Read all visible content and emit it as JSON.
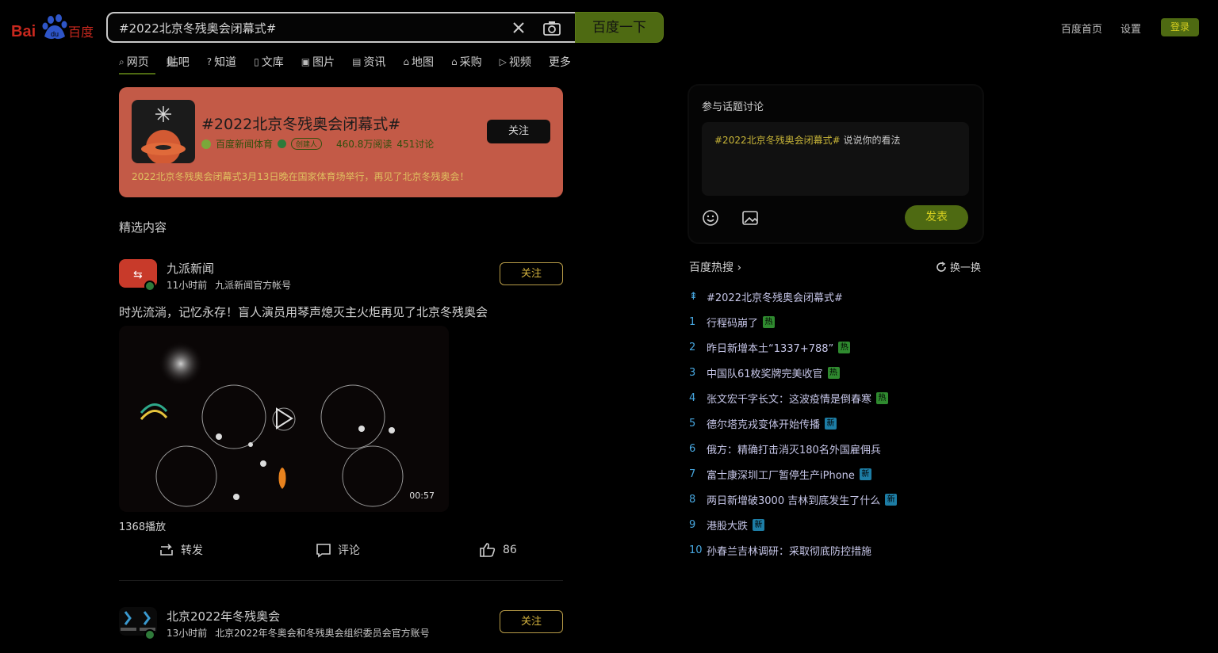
{
  "header": {
    "logo_text": "Bai 百度",
    "search_value": "#2022北京冬残奥会闭幕式#",
    "search_button": "百度一下",
    "links": [
      "百度首页",
      "设置"
    ],
    "login": "登录"
  },
  "nav": {
    "items": [
      {
        "label": "网页",
        "icon": "search-icon"
      },
      {
        "label": "贴吧",
        "icon": "tieba-icon"
      },
      {
        "label": "知道",
        "icon": "question-icon"
      },
      {
        "label": "文库",
        "icon": "doc-icon"
      },
      {
        "label": "图片",
        "icon": "picture-icon"
      },
      {
        "label": "资讯",
        "icon": "news-icon"
      },
      {
        "label": "地图",
        "icon": "map-icon"
      },
      {
        "label": "采购",
        "icon": "shop-icon"
      },
      {
        "label": "视频",
        "icon": "video-icon"
      },
      {
        "label": "更多",
        "icon": ""
      }
    ]
  },
  "topic": {
    "title": "#2022北京冬残奥会闭幕式#",
    "source": "百度新闻体育",
    "badge": "创建人",
    "reads": "460.8万阅读",
    "discussions": "451讨论",
    "follow": "关注",
    "description": "2022北京冬残奥会闭幕式3月13日晚在国家体育场举行，再见了北京冬残奥会！"
  },
  "section_title": "精选内容",
  "posts": [
    {
      "author": "九派新闻",
      "time": "11小时前",
      "account": "九派新闻官方帐号",
      "follow": "关注",
      "text": "时光流淌，记忆永存！盲人演员用琴声熄灭主火炬再见了北京冬残奥会",
      "duration": "00:57",
      "plays": "1368播放",
      "actions": {
        "share": "转发",
        "comment": "评论",
        "like": "86"
      }
    },
    {
      "author": "北京2022年冬残奥会",
      "time": "13小时前",
      "account": "北京2022年冬奥会和冬残奥会组织委员会官方账号",
      "follow": "关注"
    }
  ],
  "discuss": {
    "title": "参与话题讨论",
    "tag": "#2022北京冬残奥会闭幕式#",
    "placeholder": "说说你的看法",
    "publish": "发表"
  },
  "hot": {
    "title": "百度热搜",
    "refresh": "换一换",
    "pinned": "#2022北京冬残奥会闭幕式#",
    "items": [
      {
        "rank": "1",
        "text": "行程码崩了",
        "tag": "热"
      },
      {
        "rank": "2",
        "text": "昨日新增本土“1337+788”",
        "tag": "热"
      },
      {
        "rank": "3",
        "text": "中国队61枚奖牌完美收官",
        "tag": "热"
      },
      {
        "rank": "4",
        "text": "张文宏千字长文：这波疫情是倒春寒",
        "tag": "热"
      },
      {
        "rank": "5",
        "text": "德尔塔克戎变体开始传播",
        "tag": "新"
      },
      {
        "rank": "6",
        "text": "俄方：精确打击消灭180名外国雇佣兵",
        "tag": ""
      },
      {
        "rank": "7",
        "text": "富士康深圳工厂暂停生产iPhone",
        "tag": "新"
      },
      {
        "rank": "8",
        "text": "两日新增破3000 吉林到底发生了什么",
        "tag": "新"
      },
      {
        "rank": "9",
        "text": "港股大跌",
        "tag": "新"
      },
      {
        "rank": "10",
        "text": "孙春兰吉林调研：采取彻底防控措施",
        "tag": ""
      }
    ]
  }
}
